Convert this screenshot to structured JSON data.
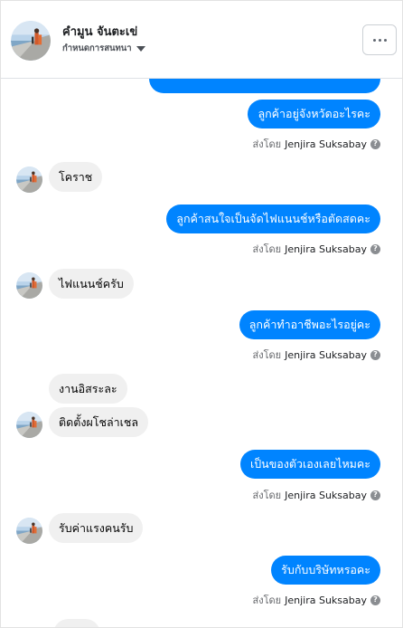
{
  "header": {
    "contact_name": "คำมูน จันตะเข่",
    "subtitle": "กำหนดการสนทนา"
  },
  "messages": {
    "m1": "ลูกค้าอยู่จังหวัดอะไรคะ",
    "m2": "โคราช",
    "m3": "ลูกค้าสนใจเป็นจัดไฟแนนช์หรือตัดสดคะ",
    "m4": "ไฟแนนช์ครับ",
    "m5": "ลูกค้าทำอาชีพอะไรอยู่คะ",
    "m6": "งานอิสระละ",
    "m7": "ติดตั้งผโชล่าเชล",
    "m8": "เป็นของตัวเองเลยไหมคะ",
    "m9": "รับค่าแรงคนรับ",
    "m10": "รับกับบริษัทหรอคะ"
  },
  "sent_by": {
    "prefix": "ส่งโดย",
    "name": "Jenjira Suksabay"
  },
  "colors": {
    "outgoing_bubble": "#0084ff",
    "incoming_bubble": "#f0f0f0"
  }
}
